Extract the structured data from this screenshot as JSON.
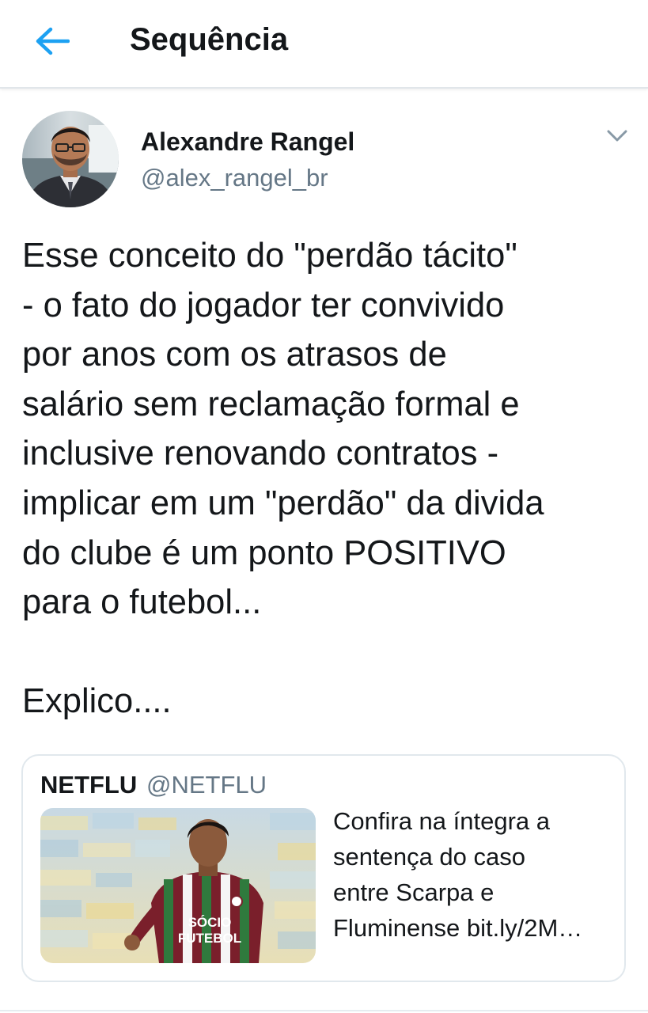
{
  "header": {
    "title": "Sequência",
    "back_icon": "arrow-left-icon",
    "accent_color": "#1da1f2"
  },
  "tweet": {
    "author": {
      "display_name": "Alexandre Rangel",
      "handle": "@alex_rangel_br"
    },
    "text": "Esse conceito do \"perdão tácito\"\n- o fato do jogador ter convivido\npor anos com os atrasos de\nsalário sem reclamação formal e\ninclusive renovando contratos -\nimplicar em um \"perdão\" da divida\ndo clube é um ponto POSITIVO\npara o futebol...\n\nExplico....",
    "menu_icon": "chevron-down-icon"
  },
  "quoted_tweet": {
    "display_name": "NETFLU",
    "handle": "@NETFLU",
    "text": "Confira na íntegra a\nsentença do caso\nentre Scarpa e\nFluminense bit.ly/2M…",
    "jersey_text": "SÓCIO\nFUTEBOL"
  },
  "colors": {
    "text_primary": "#14171a",
    "text_secondary": "#657786",
    "border": "#e1e8ed"
  }
}
